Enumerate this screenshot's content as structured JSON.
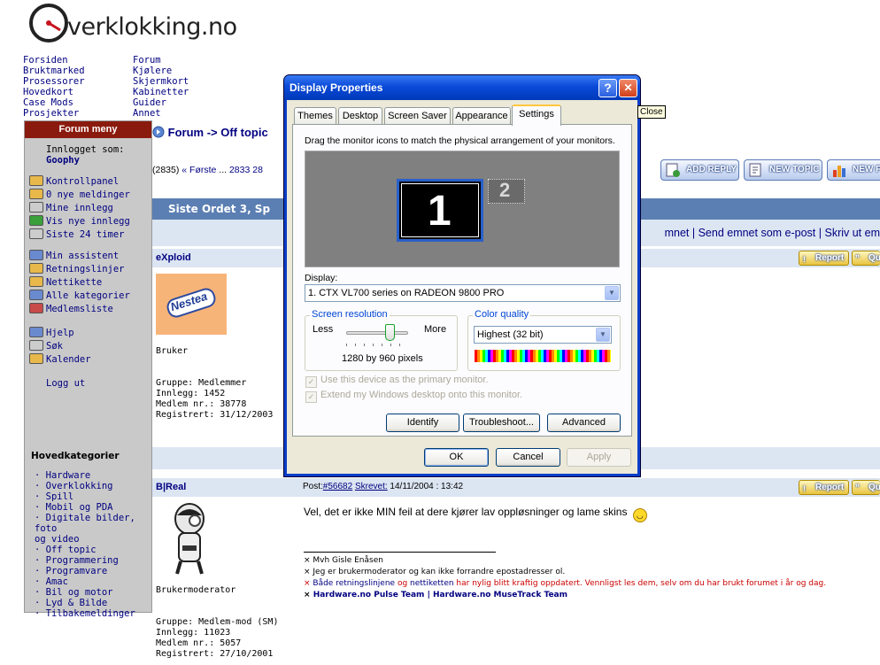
{
  "site": {
    "logo_text": "verklokking.no"
  },
  "top_links_col1": [
    "Forsiden",
    "Bruktmarked",
    "Prosessorer",
    "Hovedkort",
    "Case Mods",
    "Prosjekter"
  ],
  "top_links_col2": [
    "Forum",
    "Kjølere",
    "Skjermkort",
    "Kabinetter",
    "Guider",
    "Annet"
  ],
  "sidebar": {
    "header": "Forum meny",
    "logged_in_label": "Innlogget som:",
    "username": "Goophy",
    "group1": [
      "Kontrollpanel",
      "0 nye meldinger",
      "Mine innlegg",
      "Vis nye innlegg",
      "Siste 24 timer"
    ],
    "group2": [
      "Min assistent",
      "Retningslinjer",
      "Nettikette",
      "Alle kategorier",
      "Medlemsliste"
    ],
    "group3": [
      "Hjelp",
      "Søk",
      "Kalender"
    ],
    "logout": "Logg ut",
    "categories_header": "Hovedkategorier",
    "categories": [
      "· Hardware",
      "· Overklokking",
      "· Spill",
      "· Mobil og PDA",
      "· Digitale bilder, foto",
      "og video",
      "· Off topic",
      "· Programmering",
      "· Programvare",
      "· Amac",
      "· Bil og motor",
      "· Lyd & Bilde",
      "· Tilbakemeldinger"
    ]
  },
  "breadcrumb": {
    "forum": "Forum",
    "sep": " -> ",
    "section": "Off topic"
  },
  "pagination": {
    "prefix": "(2835)",
    "first": "« Første",
    "ellipsis": " ... ",
    "page": "2833",
    "page2": "28"
  },
  "buttons": {
    "add_reply": "ADD REPLY",
    "new_topic": "NEW TOPIC",
    "new_poll": "NEW P"
  },
  "thread": {
    "title": "Siste Ordet 3, Sp",
    "options": "mnet | Send emnet som e-post | Skriv ut em"
  },
  "posts": [
    {
      "author": "eXploid",
      "avatar_text": "Nestea",
      "rank": "Bruker",
      "group": "Gruppe: Medlemmer",
      "posts": "Innlegg: 1452",
      "member_no": "Medlem nr.: 38778",
      "registered": "Registrert: 31/12/2003",
      "report": "Report",
      "quote": "Qu"
    },
    {
      "author": "B|Real",
      "rank": "Brukermoderator",
      "group": "Gruppe: Medlem-mod (SM)",
      "posts": "Innlegg: 11023",
      "member_no": "Medlem nr.: 5057",
      "registered": "Registrert: 27/10/2001",
      "post_label": "Post:",
      "post_id": "#56682",
      "written_label": "Skrevet:",
      "written_date": " 14/11/2004 : 13:42",
      "body": "Vel, det er ikke MIN feil at dere kjører lav oppløsninger og lame skins",
      "sig1": "× Mvh Gisle Enåsen",
      "sig2": "× Jeg er brukermoderator og kan ikke forrandre epostadresser ol.",
      "sig3_prefix": "× ",
      "sig3_link1": "Både retningslinjene",
      "sig3_mid": " og ",
      "sig3_link2": "nettiketten",
      "sig3_rest": " har nylig blitt kraftig oppdatert. Vennligst les dem, selv om du har brukt forumet i år og dag.",
      "sig4_prefix": "× ",
      "sig4_link1": "Hardware.no Pulse Team",
      "sig4_sep": " | ",
      "sig4_link2": "Hardware.no MuseTrack Team",
      "report": "Report",
      "quote": "Qu"
    }
  ],
  "dialog": {
    "title": "Display Properties",
    "help_btn": "?",
    "close_btn": "✕",
    "tooltip": "Close",
    "tabs": [
      "Themes",
      "Desktop",
      "Screen Saver",
      "Appearance",
      "Settings"
    ],
    "instruction": "Drag the monitor icons to match the physical arrangement of your monitors.",
    "monitor1": "1",
    "monitor2": "2",
    "display_label": "Display:",
    "display_value": "1. CTX VL700 series on RADEON 9800 PRO",
    "resolution_label": "Screen resolution",
    "less": "Less",
    "more": "More",
    "resolution_value": "1280 by 960 pixels",
    "resolution_slider_fraction": 0.7,
    "color_label": "Color quality",
    "color_value": "Highest (32 bit)",
    "primary_check": "Use this device as the primary monitor.",
    "extend_check": "Extend my Windows desktop onto this monitor.",
    "identify": "Identify",
    "troubleshoot": "Troubleshoot...",
    "advanced": "Advanced",
    "ok": "OK",
    "cancel": "Cancel",
    "apply": "Apply"
  }
}
